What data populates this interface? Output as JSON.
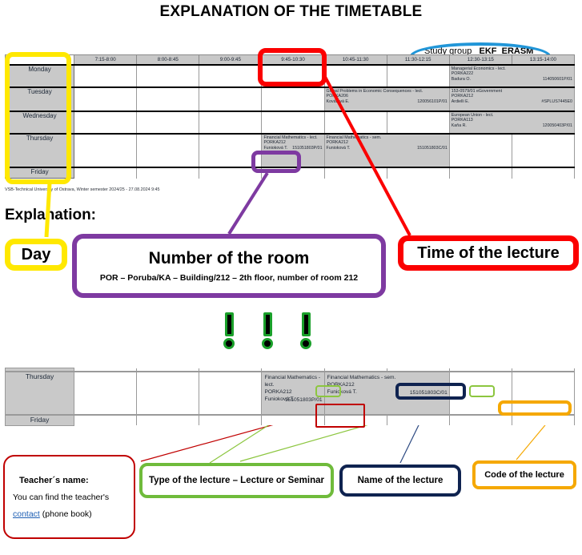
{
  "title": "EXPLANATION OF THE TIMETABLE",
  "study_group": {
    "prefix": "Study group ",
    "value": "_EKF_ERASM"
  },
  "timetable": {
    "time_headers": [
      "7:15-8:00",
      "8:00-8:45",
      "9:00-9:45",
      "9:45-10:30",
      "10:45-11:30",
      "11:30-12:15",
      "12:30-13:15",
      "13:15-14:00"
    ],
    "days": [
      "Monday",
      "Tuesday",
      "Wednesday",
      "Thursday",
      "Friday"
    ],
    "events": {
      "monday": {
        "name": "Managerial Economics - lect.",
        "room": "PORKA222",
        "teacher": "Badura O.",
        "code": "114050601P/01"
      },
      "tuesday_a": {
        "name": "Global Problems in Economic Consequences - lect.",
        "room": "PORKA206",
        "teacher": "Kovářová E.",
        "code": "120056101P/01"
      },
      "tuesday_b": {
        "name": "153-0579/01 eGovernment",
        "room": "PORKA212",
        "teacher": "Ardielli E.",
        "code": "#SPLUS7445E0"
      },
      "wednesday": {
        "name": "European Union - lect.",
        "room": "PORKA113",
        "teacher": "Kaňa R.",
        "code": "120050403P/01"
      },
      "thursday_lect": {
        "name": "Financial Mathematics - lect.",
        "room": "PORKA212",
        "teacher": "Funioková T.",
        "code": "151051803P/01"
      },
      "thursday_sem": {
        "name": "Financial Mathematics - sem.",
        "room": "PORKA212",
        "teacher": "Funioková T.",
        "code": "151051803C/01"
      }
    },
    "footnote": "VSB-Technical University of Ostrava, Winter semester 2024/25 - 27.08.2024 9:45"
  },
  "explanation": {
    "heading": "Explanation:",
    "day_box": "Day",
    "room_box_title": "Number of the room",
    "room_box_sub": "POR – Poruba/KA – Building/212 – 2th floor, number of room 212",
    "time_box": "Time of the lecture"
  },
  "legend": {
    "teacher": {
      "line1": "Teacher´s name:",
      "line2": "You can find the teacher's",
      "link": "contact",
      "line3_rest": " (phone book)"
    },
    "type": "Type of the lecture – Lecture or Seminar",
    "name": "Name of the lecture",
    "code": "Code of the lecture"
  },
  "colors": {
    "yellow": "#ffe800",
    "red": "#fb0000",
    "purple": "#7e3aa1",
    "blue_oval": "#2196d8",
    "green": "#6fbb3b",
    "navy": "#0f2350",
    "orange": "#f5a800",
    "dark_red": "#c00000",
    "excl_green": "#1aa02a"
  }
}
